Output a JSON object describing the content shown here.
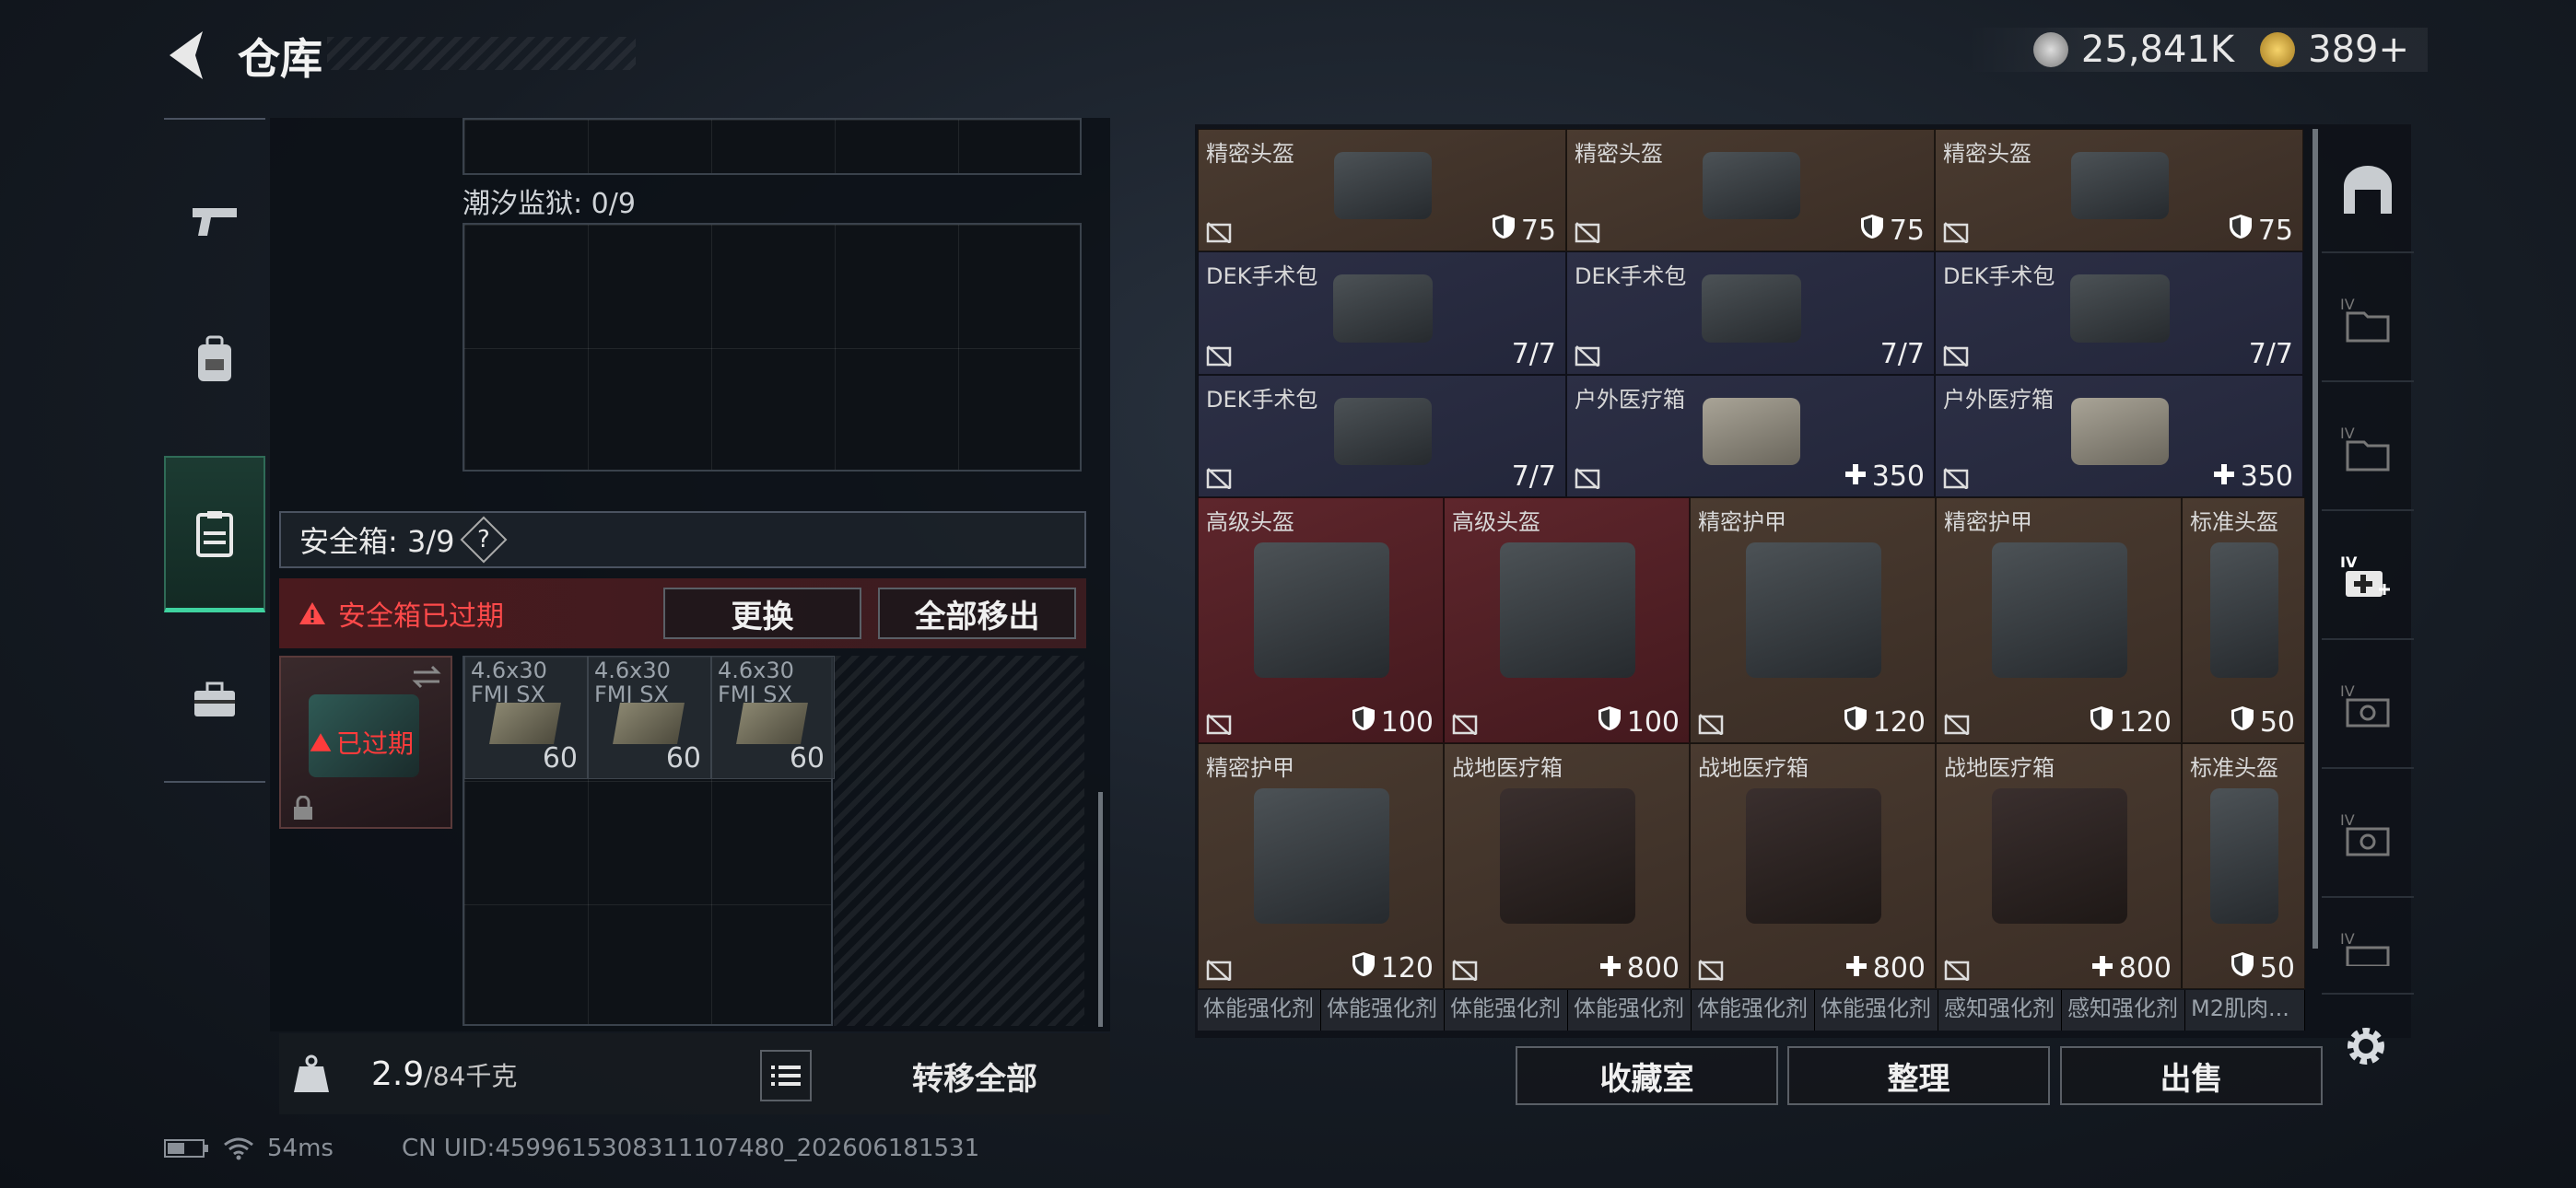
{
  "header": {
    "title": "仓库",
    "currency_a": "25,841K",
    "currency_b": "389+"
  },
  "left": {
    "container_label": "潮汐监狱: 0/9",
    "safe_label": "安全箱: 3/9",
    "safe_help": "?",
    "alert_text": "安全箱已过期",
    "replace_label": "更换",
    "remove_all_label": "全部移出",
    "expired_text": "已过期",
    "ammo": [
      {
        "name1": "4.6x30",
        "name2": "FMJ SX",
        "count": "60"
      },
      {
        "name1": "4.6x30",
        "name2": "FMJ SX",
        "count": "60"
      },
      {
        "name1": "4.6x30",
        "name2": "FMJ SX",
        "count": "60"
      }
    ],
    "weight_value": "2.9",
    "weight_max": "/84千克",
    "transfer_all_label": "转移全部"
  },
  "right": {
    "items": [
      {
        "name": "精密头盔",
        "value": "75",
        "icon": "shield-icon",
        "bg": "brown"
      },
      {
        "name": "精密头盔",
        "value": "75",
        "icon": "shield-icon",
        "bg": "brown"
      },
      {
        "name": "精密头盔",
        "value": "75",
        "icon": "shield-icon",
        "bg": "brown"
      },
      {
        "name": "DEK手术包",
        "value": "7/7",
        "icon": "",
        "bg": "navy"
      },
      {
        "name": "DEK手术包",
        "value": "7/7",
        "icon": "",
        "bg": "navy"
      },
      {
        "name": "DEK手术包",
        "value": "7/7",
        "icon": "",
        "bg": "navy"
      },
      {
        "name": "DEK手术包",
        "value": "7/7",
        "icon": "",
        "bg": "navy"
      },
      {
        "name": "户外医疗箱",
        "value": "350",
        "icon": "plus-icon",
        "bg": "navy"
      },
      {
        "name": "户外医疗箱",
        "value": "350",
        "icon": "plus-icon",
        "bg": "navy"
      },
      {
        "name": "高级头盔",
        "value": "100",
        "icon": "shield-icon",
        "bg": "red"
      },
      {
        "name": "高级头盔",
        "value": "100",
        "icon": "shield-icon",
        "bg": "red"
      },
      {
        "name": "精密护甲",
        "value": "120",
        "icon": "shield-icon",
        "bg": "brown"
      },
      {
        "name": "精密护甲",
        "value": "120",
        "icon": "shield-icon",
        "bg": "brown"
      },
      {
        "name": "标准头盔",
        "value": "50",
        "icon": "shield-icon",
        "bg": "brown"
      },
      {
        "name": "精密护甲",
        "value": "120",
        "icon": "shield-icon",
        "bg": "brown"
      },
      {
        "name": "战地医疗箱",
        "value": "800",
        "icon": "plus-icon",
        "bg": "brown"
      },
      {
        "name": "战地医疗箱",
        "value": "800",
        "icon": "plus-icon",
        "bg": "brown"
      },
      {
        "name": "战地医疗箱",
        "value": "800",
        "icon": "plus-icon",
        "bg": "brown"
      },
      {
        "name": "标准头盔",
        "value": "50",
        "icon": "shield-icon",
        "bg": "brown"
      }
    ],
    "bottom_row": [
      "体能强化剂",
      "体能强化剂",
      "体能强化剂",
      "体能强化剂",
      "体能强化剂",
      "体能强化剂",
      "感知强化剂",
      "感知强化剂",
      "M2肌肉..."
    ],
    "collection_label": "收藏室",
    "sort_label": "整理",
    "sell_label": "出售"
  },
  "status": {
    "ping": "54ms",
    "uid": "CN UID:4599615308311107480_202606181531"
  },
  "colors": {
    "accent": "#3fd3a0",
    "alert": "#ff4a4a",
    "brown": "#4a3b30",
    "navy": "#2c2f45",
    "red": "#5e262c"
  }
}
